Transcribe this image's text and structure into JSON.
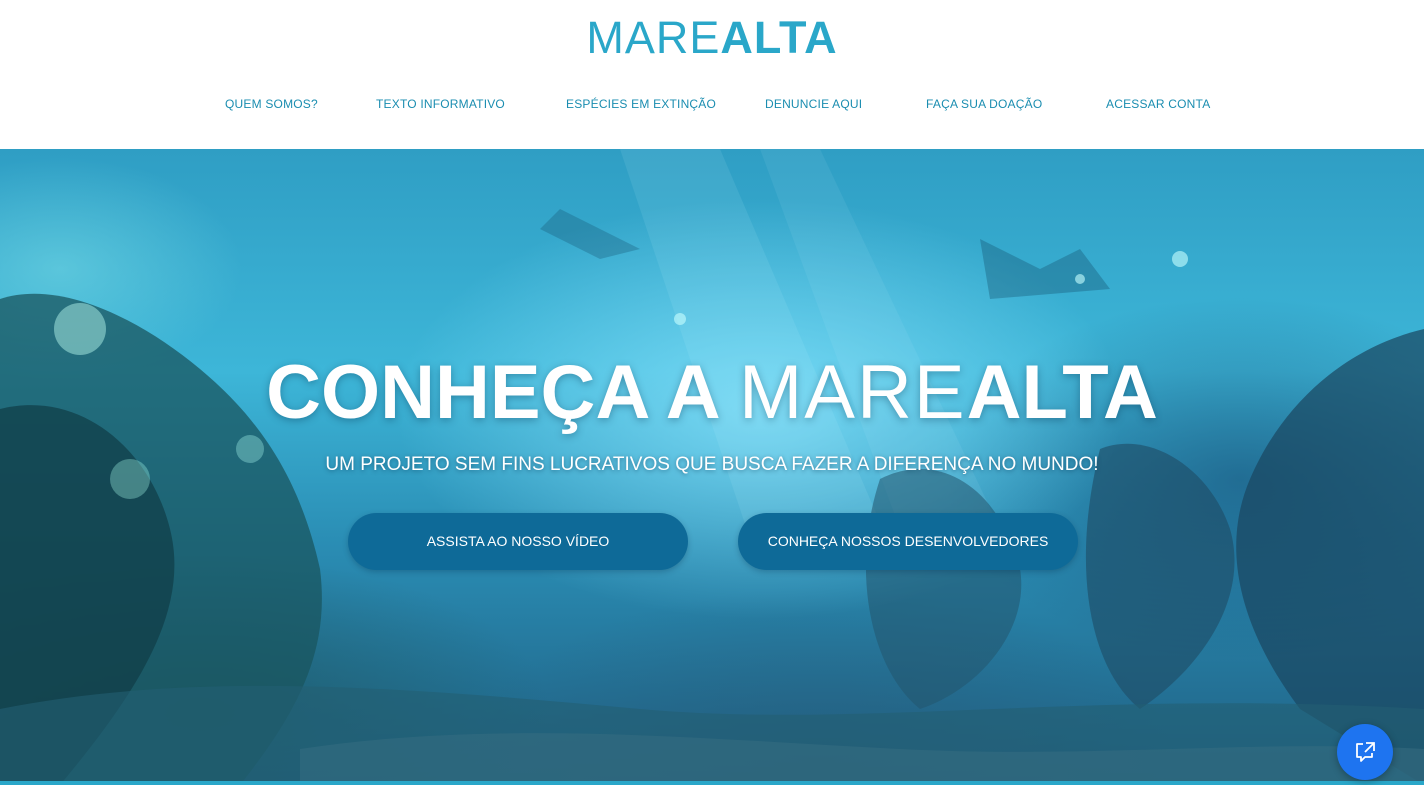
{
  "header": {
    "logo": {
      "part1": "MARE",
      "part2": "ALTA"
    },
    "nav": [
      {
        "label": "QUEM SOMOS?"
      },
      {
        "label": "TEXTO INFORMATIVO"
      },
      {
        "label": "ESPÉCIES EM EXTINÇÃO"
      },
      {
        "label": "DENUNCIE AQUI"
      },
      {
        "label": "FAÇA SUA DOAÇÃO"
      },
      {
        "label": "ACESSAR CONTA"
      }
    ]
  },
  "hero": {
    "title_prefix": "CONHEÇA A ",
    "title_brand_thin": "MARE",
    "title_brand_bold": "ALTA",
    "subtitle": "UM PROJETO SEM FINS LUCRATIVOS QUE BUSCA FAZER A DIFERENÇA NO MUNDO!",
    "buttons": {
      "video": "ASSISTA AO NOSSO VÍDEO",
      "developers": "CONHEÇA NOSSOS DESENVOLVEDORES"
    }
  },
  "widgets": {
    "chat_icon": "external-chat-icon"
  },
  "colors": {
    "brand": "#2aa7c9",
    "nav_text": "#1a8db0",
    "button_bg": "#0e6a98",
    "chat_button": "#1e74f0"
  }
}
